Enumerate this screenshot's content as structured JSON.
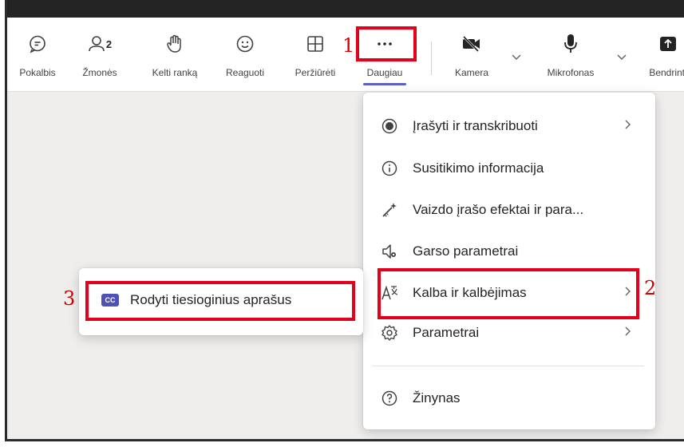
{
  "toolbar": {
    "items": [
      {
        "label": "Pokalbis",
        "icon": "chat-icon"
      },
      {
        "label": "Žmonės",
        "icon": "people-icon",
        "count": "2"
      },
      {
        "label": "Kelti ranką",
        "icon": "raise-hand-icon"
      },
      {
        "label": "Reaguoti",
        "icon": "smiley-icon"
      },
      {
        "label": "Peržiūrėti",
        "icon": "grid-view-icon"
      },
      {
        "label": "Daugiau",
        "icon": "more-icon",
        "active": true
      },
      {
        "label": "Kamera",
        "icon": "camera-off-icon"
      },
      {
        "label": "Mikrofonas",
        "icon": "microphone-icon"
      },
      {
        "label": "Bendrinti",
        "icon": "share-icon"
      }
    ]
  },
  "menu": {
    "items": [
      {
        "label": "Įrašyti ir transkribuoti",
        "icon": "record-icon",
        "has_submenu": true
      },
      {
        "label": "Susitikimo informacija",
        "icon": "info-icon",
        "has_submenu": false
      },
      {
        "label": "Vaizdo įrašo efektai ir para...",
        "icon": "magic-wand-icon",
        "has_submenu": false
      },
      {
        "label": "Garso parametrai",
        "icon": "speaker-settings-icon",
        "has_submenu": false
      },
      {
        "label": "Kalba ir kalbėjimas",
        "icon": "language-icon",
        "has_submenu": true
      },
      {
        "label": "Parametrai",
        "icon": "gear-icon",
        "has_submenu": true
      },
      {
        "label": "Žinynas",
        "icon": "help-icon",
        "has_submenu": false
      }
    ]
  },
  "submenu": {
    "item_label": "Rodyti tiesioginius aprašus",
    "badge": "CC"
  },
  "annotations": {
    "marker1": "1",
    "marker2": "2",
    "marker3": "3"
  },
  "colors": {
    "accent": "#5b5fc7",
    "highlight_box": "#e3001b",
    "marker": "#d10000",
    "cc_badge": "#4f52b2"
  }
}
